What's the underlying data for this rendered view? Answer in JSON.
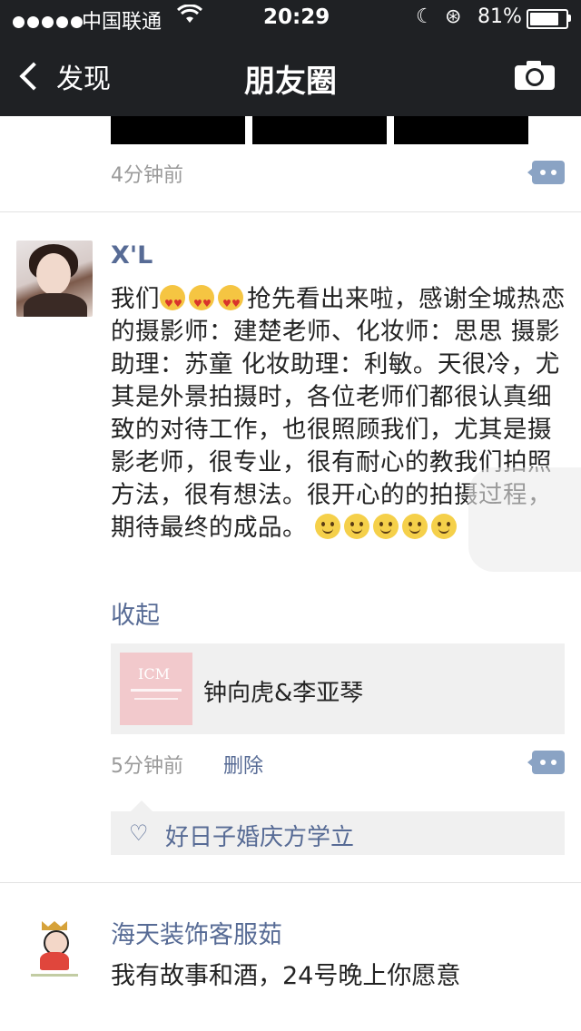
{
  "status_bar": {
    "carrier": "中国联通",
    "time": "20:29",
    "battery_percent": "81%",
    "battery_level": 0.81
  },
  "nav": {
    "back_label": "发现",
    "title": "朋友圈",
    "camera_icon": "camera-icon"
  },
  "prev_post": {
    "time": "4分钟前"
  },
  "post": {
    "username": "X'L",
    "text_part1": "我们",
    "text_part2": "抢先看出来啦，感谢全城热恋的摄影师：建楚老师、化妆师：思思 摄影助理：苏童 化妆助理：利敏。天很冷，尤其是外景拍摄时，各位老师们都很认真细致的对待工作，也很照顾我们，尤其是摄影老师，很专业，很有耐心的教我们拍照方法，很有想法。很开心的的拍摄过程，期待最终的成品。",
    "collapse_label": "收起",
    "link_title": "钟向虎&李亚琴",
    "link_thumb_text": "ICM",
    "time": "5分钟前",
    "delete_label": "删除",
    "like_name": "好日子婚庆方学立"
  },
  "next_post": {
    "username": "海天装饰客服茹",
    "text": "我有故事和酒，24号晚上你愿意"
  },
  "colors": {
    "nav_bg": "#1f2124",
    "link_blue": "#576b95",
    "comment_btn": "#8aa3c4"
  }
}
